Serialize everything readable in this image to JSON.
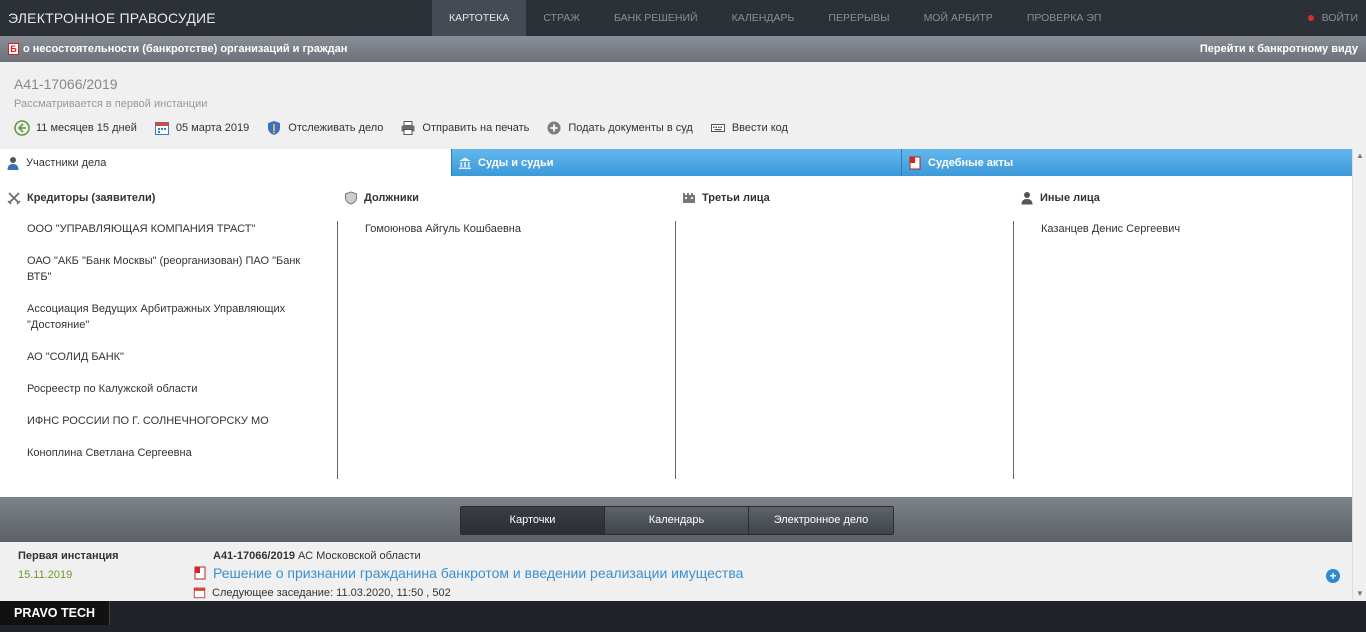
{
  "topbar": {
    "brand": "ЭЛЕКТРОННОЕ ПРАВОСУДИЕ",
    "nav": [
      {
        "label": "КАРТОТЕКА",
        "active": true
      },
      {
        "label": "СТРАЖ",
        "active": false
      },
      {
        "label": "БАНК РЕШЕНИЙ",
        "active": false
      },
      {
        "label": "КАЛЕНДАРЬ",
        "active": false
      },
      {
        "label": "ПЕРЕРЫВЫ",
        "active": false
      },
      {
        "label": "МОЙ АРБИТР",
        "active": false
      },
      {
        "label": "ПРОВЕРКА ЭП",
        "active": false
      }
    ],
    "logout": "ВОЙТИ"
  },
  "subbar": {
    "icon_letter": "Б",
    "title": "о несостоятельности (банкротстве) организаций и граждан",
    "link": "Перейти к банкротному виду"
  },
  "case": {
    "number": "А41-17066/2019",
    "status": "Рассматривается в первой инстанции",
    "actions": [
      {
        "icon": "back-arrow-icon",
        "label": "11 месяцев 15 дней"
      },
      {
        "icon": "calendar-icon",
        "label": "05 марта 2019"
      },
      {
        "icon": "shield-icon",
        "label": "Отслеживать дело"
      },
      {
        "icon": "printer-icon",
        "label": "Отправить на печать"
      },
      {
        "icon": "plus-circle-icon",
        "label": "Подать документы в суд"
      },
      {
        "icon": "keyboard-icon",
        "label": "Ввести код"
      }
    ]
  },
  "tabs": [
    {
      "label": "Участники дела",
      "active": true
    },
    {
      "label": "Суды и судьи",
      "active": false
    },
    {
      "label": "Судебные акты",
      "active": false
    }
  ],
  "participants": {
    "creditors": {
      "title": "Кредиторы (заявители)",
      "items": [
        "ООО \"УПРАВЛЯЮЩАЯ КОМПАНИЯ ТРАСТ\"",
        "ОАО \"АКБ \"Банк Москвы\" (реорганизован) ПАО \"Банк ВТБ\"",
        "Ассоциация Ведущих Арбитражных Управляющих \"Достояние\"",
        "АО \"СОЛИД БАНК\"",
        "Росреестр по Калужской области",
        "ИФНС РОССИИ ПО Г. СОЛНЕЧНОГОРСКУ МО",
        "Коноплина Светлана Сергеевна"
      ]
    },
    "debtors": {
      "title": "Должники",
      "items": [
        "Гомоюнова Айгуль Кошбаевна"
      ]
    },
    "third": {
      "title": "Третьи лица",
      "items": []
    },
    "others": {
      "title": "Иные лица",
      "items": [
        "Казанцев Денис Сергеевич"
      ]
    }
  },
  "bottom_tabs": [
    {
      "label": "Карточки",
      "active": true
    },
    {
      "label": "Календарь",
      "active": false
    },
    {
      "label": "Электронное дело",
      "active": false
    }
  ],
  "instance": {
    "label": "Первая инстанция",
    "date": "15.11.2019",
    "case_number": "А41-17066/2019",
    "court": "АС Московской области",
    "document": "Решение о признании гражданина банкротом и введении реализации имущества",
    "next_hearing": "Следующее заседание: 11.03.2020, 11:50 , 502"
  },
  "footer": {
    "brand": "PRAVO TECH"
  },
  "colors": {
    "topbar": "#2c3037",
    "tab_blue": "#4aa6e3",
    "link_blue": "#3b8fd0",
    "date_green": "#6a9a2a"
  }
}
